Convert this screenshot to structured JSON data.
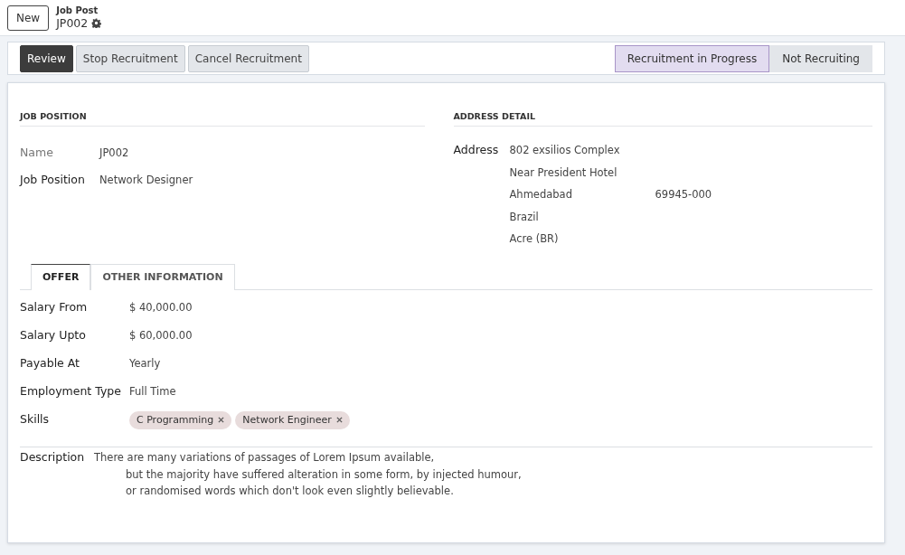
{
  "control_panel": {
    "new_button": "New",
    "breadcrumb": "Job Post",
    "record_name": "JP002"
  },
  "action_buttons": [
    {
      "label": "Review",
      "kind": "primary"
    },
    {
      "label": "Stop Recruitment",
      "kind": "secondary"
    },
    {
      "label": "Cancel Recruitment",
      "kind": "secondary"
    }
  ],
  "stages": [
    {
      "label": "Recruitment in Progress",
      "selected": true
    },
    {
      "label": "Not Recruiting",
      "selected": false
    }
  ],
  "job_position": {
    "heading": "JOB POSITION",
    "fields": [
      {
        "label": "Name",
        "value": "JP002",
        "muted": true
      },
      {
        "label": "Job Position",
        "value": "Network Designer",
        "muted": false
      }
    ]
  },
  "address_detail": {
    "heading": "ADDRESS DETAIL",
    "label": "Address",
    "street": "802 exsilios Complex",
    "street2": "Near President Hotel",
    "city": "Ahmedabad",
    "zip": "69945-000",
    "country": "Brazil",
    "state": "Acre (BR)"
  },
  "tabs": [
    {
      "label": "OFFER",
      "selected": true
    },
    {
      "label": "OTHER INFORMATION",
      "selected": false
    }
  ],
  "offer": [
    {
      "label": "Salary From",
      "currency": "$",
      "value": "40,000.00"
    },
    {
      "label": "Salary Upto",
      "currency": "$",
      "value": "60,000.00"
    },
    {
      "label": "Payable At",
      "value": "Yearly"
    },
    {
      "label": "Employment Type",
      "value": "Full Time"
    }
  ],
  "skills": {
    "label": "Skills",
    "tags": [
      "C Programming",
      "Network Engineer"
    ]
  },
  "description": {
    "label": "Description",
    "lines": [
      "There are many variations of passages of Lorem Ipsum available,",
      "but the majority have suffered alteration in some form, by injected humour,",
      "or randomised words which don't look even slightly believable."
    ]
  }
}
